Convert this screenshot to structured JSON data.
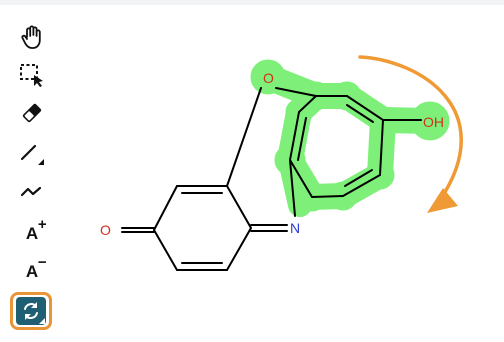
{
  "toolbar": {
    "tools": [
      {
        "name": "hand",
        "icon": "hand-icon"
      },
      {
        "name": "select",
        "icon": "rectangle-select-icon"
      },
      {
        "name": "erase",
        "icon": "eraser-icon"
      },
      {
        "name": "bond",
        "icon": "single-bond-icon"
      },
      {
        "name": "chain",
        "icon": "chain-icon"
      },
      {
        "name": "charge-plus",
        "label": "A",
        "sup": "+"
      },
      {
        "name": "charge-minus",
        "label": "A",
        "sup": "−"
      },
      {
        "name": "rotate",
        "icon": "rotate-icon",
        "active": true
      }
    ]
  },
  "molecule": {
    "atoms": {
      "o_ring": "O",
      "oh": "OH",
      "o_carbonyl": "O",
      "n": "N"
    }
  },
  "colors": {
    "highlight": "#7ef07a",
    "heteroatom": "#d0311f",
    "nitrogen": "#2b3bd0",
    "bond": "#000000",
    "rotate_arrow": "#ef9a34",
    "active_tool_border": "#e8953a",
    "active_tool_bg": "#1f5f74"
  }
}
